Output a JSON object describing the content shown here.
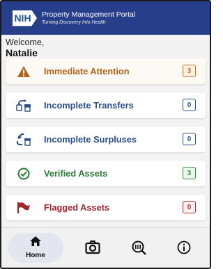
{
  "header": {
    "logo_text": "NIH",
    "title": "Property Management Portal",
    "subtitle": "Turning Discovery Into Health"
  },
  "welcome": {
    "label": "Welcome,",
    "name": "Natalie"
  },
  "cards": [
    {
      "label": "Immediate Attention",
      "count": "3",
      "icon": "warning-icon",
      "text_color": "#b3631a",
      "badge_color": "#c0722e",
      "badge_bg": "#fdf1e6"
    },
    {
      "label": "Incomplete Transfers",
      "count": "0",
      "icon": "transfer-icon",
      "text_color": "#2b4f86",
      "badge_color": "#2b4f86",
      "badge_bg": "#ffffff"
    },
    {
      "label": "Incomplete Surpluses",
      "count": "0",
      "icon": "recycle-icon",
      "text_color": "#2b4f86",
      "badge_color": "#2b4f86",
      "badge_bg": "#ffffff"
    },
    {
      "label": "Verified Assets",
      "count": "3",
      "icon": "check-circle-icon",
      "text_color": "#2f7a3a",
      "badge_color": "#3a8a45",
      "badge_bg": "#eef8ef"
    },
    {
      "label": "Flagged Assets",
      "count": "0",
      "icon": "flag-icon",
      "text_color": "#a1262e",
      "badge_color": "#b0353c",
      "badge_bg": "#fcefef"
    }
  ],
  "nav": {
    "home_label": "Home",
    "items": [
      "home-icon",
      "camera-icon",
      "barcode-search-icon",
      "info-icon"
    ]
  }
}
